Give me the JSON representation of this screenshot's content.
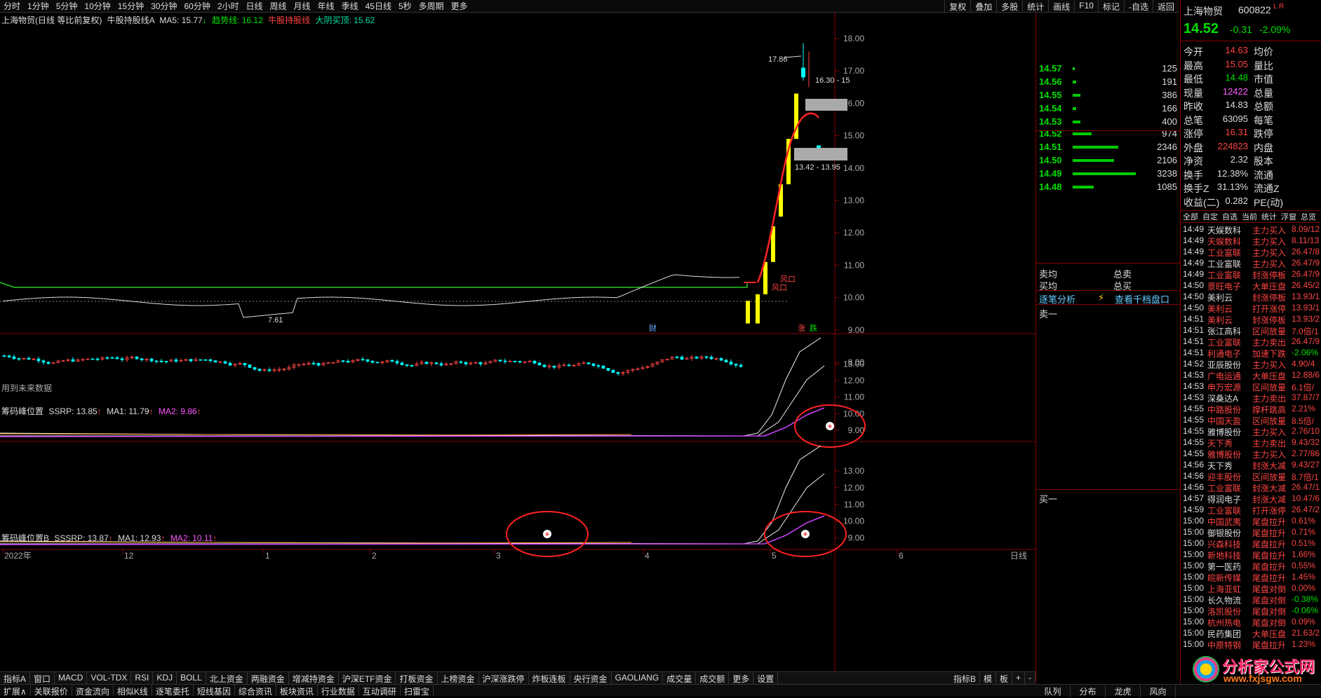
{
  "toolbar": {
    "periods": [
      "分时",
      "1分钟",
      "5分钟",
      "10分钟",
      "15分钟",
      "30分钟",
      "60分钟",
      "2小时",
      "日线",
      "周线",
      "月线",
      "年线",
      "季线",
      "45日线",
      "5秒",
      "多周期",
      "更多"
    ],
    "right": [
      "复权",
      "叠加",
      "多股",
      "统计",
      "画线",
      "F10",
      "标记",
      "-自选",
      "返回"
    ]
  },
  "main": {
    "title": "上海物贸(日线 等比前复权)",
    "indicator": "牛股持股线A",
    "ma5": "MA5: 15.77",
    "trend": "趋势线: 16.12",
    "bull": "牛股持股线",
    "yang": "大阴买顶: 15.62",
    "future_note": "用到未来数据",
    "y_ticks": [
      "18.00",
      "17.00",
      "16.00",
      "15.00",
      "14.00",
      "13.00",
      "12.00",
      "11.00",
      "10.00",
      "9.00",
      "8.00"
    ],
    "high_label": "17.86",
    "low_label": "7.61",
    "zone_top": "16.30 - 15",
    "zone_bot": "13.42 - 13.95",
    "fengkou1": "风口",
    "fengkou2": "风口",
    "cai": "财",
    "zhang": "涨",
    "die": "跌"
  },
  "ind1": {
    "name": "筹码峰位置",
    "v1": "SSRP: 13.85",
    "v2": "MA1: 11.79",
    "v3": "MA2: 9.86",
    "y_ticks": [
      "13.00",
      "12.00",
      "11.00",
      "10.00",
      "9.00"
    ]
  },
  "ind2": {
    "name": "筹码峰位置B",
    "v1": "SSSRP: 13.87",
    "v2": "MA1: 12.93",
    "v3": "MA2: 10.11",
    "y_ticks": [
      "13.00",
      "12.00",
      "11.00",
      "10.00",
      "9.00"
    ]
  },
  "xaxis": {
    "labels": [
      "2022年",
      "12",
      "1",
      "2",
      "3",
      "4",
      "5",
      "6"
    ],
    "right": "日线"
  },
  "tabs": [
    "指标A",
    "窗口",
    "MACD",
    "VOL-TDX",
    "RSI",
    "KDJ",
    "BOLL",
    "北上资金",
    "两融资金",
    "增减持资金",
    "沪深ETF资金",
    "打板资金",
    "上榜资金",
    "沪深涨跌停",
    "炸板连板",
    "央行资金",
    "GAOLIANG",
    "成交量",
    "成交额",
    "更多",
    "设置"
  ],
  "tabs_right": [
    "指标B",
    "模",
    "板"
  ],
  "bottom": [
    "扩展∧",
    "关联报价",
    "资金流向",
    "相似K线",
    "逐笔委托",
    "短线基因",
    "综合资讯",
    "板块资讯",
    "行业数据",
    "互动调研",
    "扫雷宝"
  ],
  "bottom_right": [
    "队列",
    "分布",
    "龙虎",
    "风向"
  ],
  "orderbook": {
    "buy": [
      {
        "p": "14.57",
        "v": "125"
      },
      {
        "p": "14.56",
        "v": "191"
      },
      {
        "p": "14.55",
        "v": "386"
      },
      {
        "p": "14.54",
        "v": "166"
      },
      {
        "p": "14.53",
        "v": "400"
      }
    ],
    "sell": [
      {
        "p": "14.52",
        "v": "974"
      },
      {
        "p": "14.51",
        "v": "2346"
      },
      {
        "p": "14.50",
        "v": "2106"
      },
      {
        "p": "14.49",
        "v": "3238"
      },
      {
        "p": "14.48",
        "v": "1085"
      }
    ],
    "maijun": "卖均",
    "mai_jun2": "买均",
    "zongmai": "总卖",
    "zongmai2": "总买",
    "zhubi": "逐笔分析",
    "qiandang": "查看千档盘口",
    "sell1": "卖一",
    "buy1": "买一"
  },
  "quote": {
    "name": "上海物贸",
    "code": "600822",
    "lr": "L R",
    "price": "14.52",
    "chg": "-0.31",
    "pct": "-2.09%",
    "rows": [
      [
        "今开",
        "14.63",
        "均价"
      ],
      [
        "最高",
        "15.05",
        "量比"
      ],
      [
        "最低",
        "14.48",
        "市值"
      ],
      [
        "现量",
        "12422",
        "总量"
      ],
      [
        "昨收",
        "14.83",
        "总额"
      ],
      [
        "总笔",
        "63095",
        "每笔"
      ],
      [
        "涨停",
        "16.31",
        "跌停"
      ],
      [
        "外盘",
        "224823",
        "内盘"
      ],
      [
        "净资",
        "2.32",
        "股本"
      ],
      [
        "换手",
        "12.38%",
        "流通"
      ],
      [
        "换手Z",
        "31.13%",
        "流通Z"
      ],
      [
        "收益(二)",
        "0.282",
        "PE(动)"
      ]
    ],
    "tabs": [
      "全部",
      "自定",
      "自选",
      "当前",
      "统计",
      "浮窗",
      "总览"
    ]
  },
  "ticks": [
    [
      "14:49",
      "天娱数科",
      "主力买入",
      "8.09/12"
    ],
    [
      "14:49",
      "天娱数科",
      "主力买入",
      "8.11/13"
    ],
    [
      "14:49",
      "工业富联",
      "主力买入",
      "26.47/8"
    ],
    [
      "14:49",
      "工业富联",
      "主力买入",
      "26.47/9"
    ],
    [
      "14:49",
      "工业富联",
      "封涨停板",
      "26.47/9"
    ],
    [
      "14:50",
      "景旺电子",
      "大单压盘",
      "26.45/2"
    ],
    [
      "14:50",
      "美利云",
      "封涨停板",
      "13.93/1"
    ],
    [
      "14:50",
      "美利云",
      "打开涨停",
      "13.93/1"
    ],
    [
      "14:51",
      "美利云",
      "封涨停板",
      "13.93/2"
    ],
    [
      "14:51",
      "张江高科",
      "区间放量",
      "7.0倍/1"
    ],
    [
      "14:51",
      "工业富联",
      "主力卖出",
      "26.47/9"
    ],
    [
      "14:51",
      "利通电子",
      "加速下跌",
      "-2.06%"
    ],
    [
      "14:52",
      "亚辰股份",
      "主力买入",
      "4.90/4"
    ],
    [
      "14:53",
      "广电运通",
      "大单压盘",
      "12.88/6"
    ],
    [
      "14:53",
      "申万宏源",
      "区间放量",
      "6.1倍/"
    ],
    [
      "14:53",
      "深桑达A",
      "主力卖出",
      "37.87/7"
    ],
    [
      "14:55",
      "中路股份",
      "撑杆跳高",
      "2.21%"
    ],
    [
      "14:55",
      "中国天盈",
      "区间放量",
      "8.5倍/"
    ],
    [
      "14:55",
      "雅博股份",
      "主力买入",
      "2.76/10"
    ],
    [
      "14:55",
      "天下秀",
      "主力卖出",
      "9.43/32"
    ],
    [
      "14:55",
      "雅博股份",
      "主力买入",
      "2.77/86"
    ],
    [
      "14:56",
      "天下秀",
      "封涨大减",
      "9.43/27"
    ],
    [
      "14:56",
      "迎丰股份",
      "区间放量",
      "8.7倍/1"
    ],
    [
      "14:56",
      "工业富联",
      "封涨大减",
      "26.47/1"
    ],
    [
      "14:57",
      "得润电子",
      "封涨大减",
      "10.47/6"
    ],
    [
      "14:59",
      "工业富联",
      "打开涨停",
      "26.47/2"
    ],
    [
      "15:00",
      "中国武夷",
      "尾盘拉升",
      "0.61%"
    ],
    [
      "15:00",
      "御银股份",
      "尾盘拉升",
      "0.71%"
    ],
    [
      "15:00",
      "兴森科技",
      "尾盘拉升",
      "0.51%"
    ],
    [
      "15:00",
      "新地科技",
      "尾盘拉升",
      "1.66%"
    ],
    [
      "15:00",
      "第一医药",
      "尾盘拉升",
      "0.55%"
    ],
    [
      "15:00",
      "皖新传媒",
      "尾盘拉升",
      "1.45%"
    ],
    [
      "15:00",
      "上海亚虹",
      "尾盘对倒",
      "0.00%"
    ],
    [
      "15:00",
      "长久物流",
      "尾盘对倒",
      "-0.38%"
    ],
    [
      "15:00",
      "洛凯股份",
      "尾盘对倒",
      "-0.06%"
    ],
    [
      "15:00",
      "杭州热电",
      "尾盘对倒",
      "0.09%"
    ],
    [
      "15:00",
      "民药集团",
      "大单压盘",
      "21.63/2"
    ],
    [
      "15:00",
      "中原特钢",
      "尾盘拉升",
      "1.23%"
    ]
  ],
  "watermark": {
    "cn": "分析家公式网",
    "url": "www.fxjsgw.com"
  }
}
